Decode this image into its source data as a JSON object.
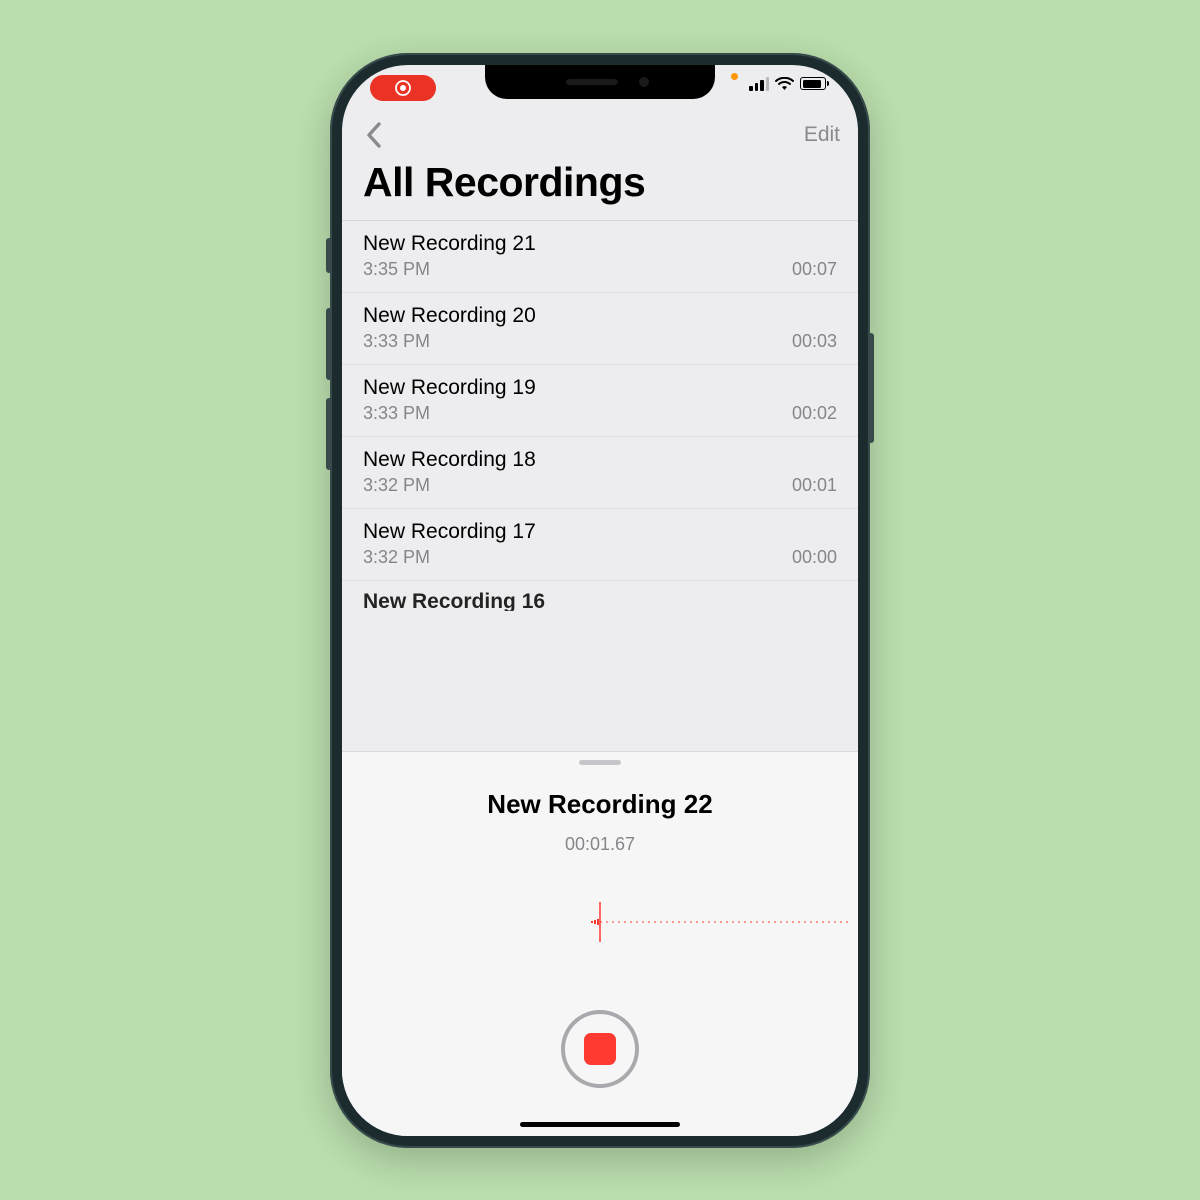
{
  "nav": {
    "edit_label": "Edit"
  },
  "page_title": "All Recordings",
  "recordings": [
    {
      "name": "New Recording 21",
      "time": "3:35 PM",
      "duration": "00:07"
    },
    {
      "name": "New Recording 20",
      "time": "3:33 PM",
      "duration": "00:03"
    },
    {
      "name": "New Recording 19",
      "time": "3:33 PM",
      "duration": "00:02"
    },
    {
      "name": "New Recording 18",
      "time": "3:32 PM",
      "duration": "00:01"
    },
    {
      "name": "New Recording 17",
      "time": "3:32 PM",
      "duration": "00:00"
    },
    {
      "name": "New Recording 16",
      "time": "",
      "duration": ""
    }
  ],
  "active": {
    "name": "New Recording 22",
    "elapsed": "00:01.67"
  }
}
